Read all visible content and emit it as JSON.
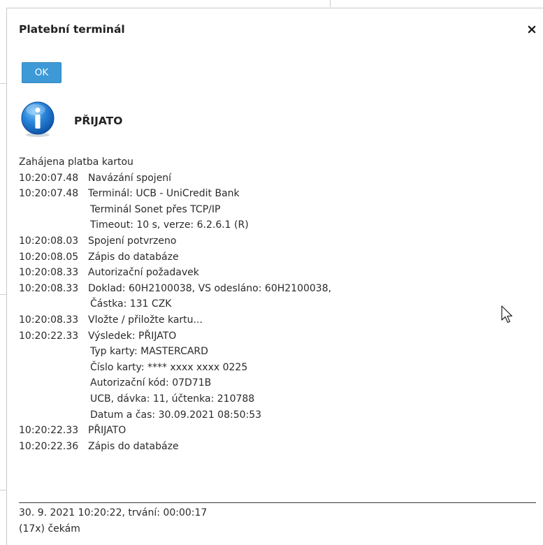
{
  "dialog": {
    "title": "Platební terminál",
    "close_label": "×",
    "ok_label": "OK",
    "status_icon": "info-icon",
    "status_title": "PŘIJATO"
  },
  "log": {
    "intro": "Zahájena platba kartou",
    "rows": [
      {
        "time": "10:20:07.48",
        "text": "Navázání spojení"
      },
      {
        "time": "10:20:07.48",
        "text": "Terminál: UCB - UniCredit Bank"
      },
      {
        "time": "",
        "text": "Terminál Sonet přes TCP/IP"
      },
      {
        "time": "",
        "text": "Timeout: 10 s,  verze: 6.2.6.1 (R)"
      },
      {
        "time": "10:20:08.03",
        "text": "Spojení potvrzeno"
      },
      {
        "time": "10:20:08.05",
        "text": "Zápis do databáze"
      },
      {
        "time": "10:20:08.33",
        "text": "Autorizační požadavek"
      },
      {
        "time": "10:20:08.33",
        "text": "Doklad: 60H2100038, VS odesláno: 60H2100038,"
      },
      {
        "time": "",
        "text": "Částka: 131 CZK"
      },
      {
        "time": "10:20:08.33",
        "text": "Vložte / přiložte kartu..."
      },
      {
        "time": "10:20:22.33",
        "text": "Výsledek: PŘIJATO"
      },
      {
        "time": "",
        "text": "Typ karty: MASTERCARD"
      },
      {
        "time": "",
        "text": "Číslo karty: **** xxxx xxxx 0225"
      },
      {
        "time": "",
        "text": "Autorizační kód: 07D71B"
      },
      {
        "time": "",
        "text": "UCB, dávka: 11, účtenka: 210788"
      },
      {
        "time": "",
        "text": "Datum a čas: 30.09.2021 08:50:53"
      },
      {
        "time": "10:20:22.33",
        "text": "PŘIJATO"
      },
      {
        "time": "10:20:22.36",
        "text": "Zápis do databáze"
      }
    ]
  },
  "footer": {
    "line1": "30. 9. 2021 10:20:22, trvání: 00:00:17",
    "line2": "(17x) čekám"
  },
  "colors": {
    "ok_button": "#3d9ad6",
    "info_icon": "#1f78d1"
  }
}
